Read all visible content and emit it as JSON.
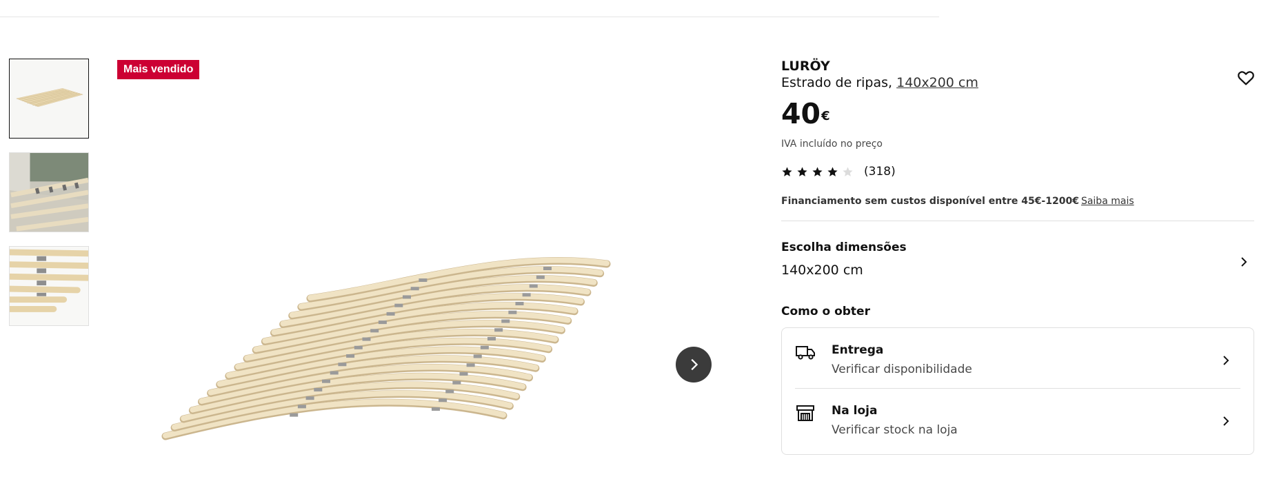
{
  "badge": {
    "text": "Mais vendido",
    "color": "#cc0033"
  },
  "product": {
    "name": "LURÖY",
    "description": "Estrado de ripas,",
    "dimension_link": "140x200 cm",
    "price_value": "40",
    "price_currency": "€",
    "vat_note": "IVA incluído no preço",
    "rating": {
      "stars_filled": 4,
      "stars_total": 5,
      "count_text": "(318)"
    },
    "financing": {
      "text": "Financiamento sem custos disponível entre 45€-1200€",
      "link": "Saiba mais"
    }
  },
  "size": {
    "label": "Escolha dimensões",
    "value": "140x200 cm"
  },
  "obtain": {
    "title": "Como o obter",
    "items": [
      {
        "title": "Entrega",
        "subtitle": "Verificar disponibilidade",
        "icon": "truck-icon"
      },
      {
        "title": "Na loja",
        "subtitle": "Verificar stock na loja",
        "icon": "store-icon"
      }
    ]
  },
  "icons": {
    "wishlist": "heart-icon",
    "next": "chevron-right-icon"
  },
  "colors": {
    "accent": "#cc0033",
    "text": "#111111",
    "muted": "#484848",
    "slat": "#ead9b4",
    "arrow_button": "#3b3b3b"
  }
}
